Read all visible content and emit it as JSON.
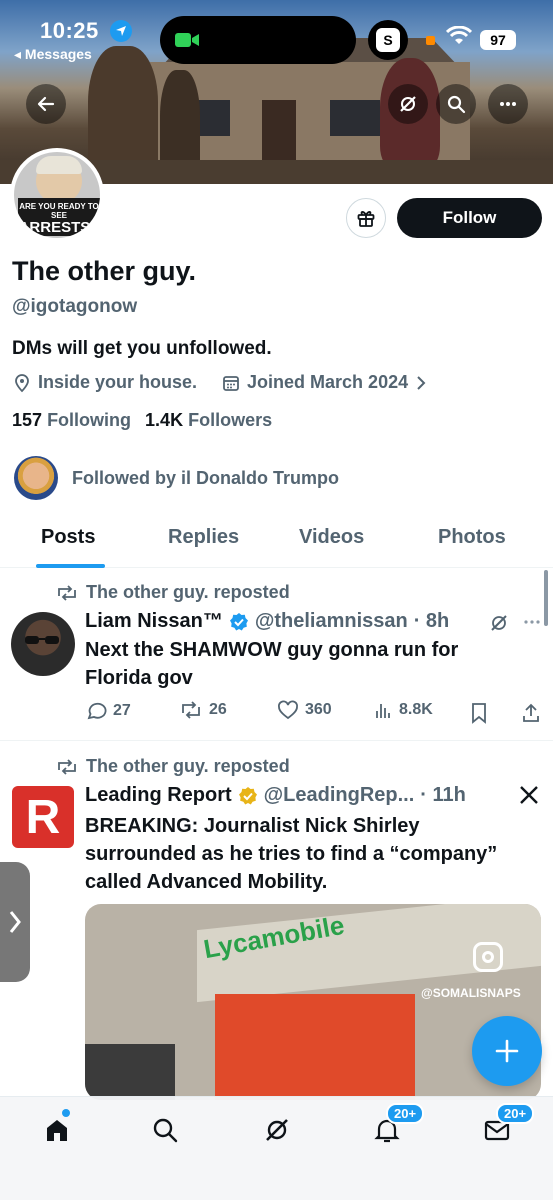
{
  "status_bar": {
    "time": "10:25",
    "back_app": "◂ Messages",
    "battery": "97",
    "app_pill_letter": "S"
  },
  "profile": {
    "name": "The other guy.",
    "handle": "@igotagonow",
    "bio": "DMs will get you unfollowed.",
    "location": "Inside your house.",
    "joined": "Joined March 2024",
    "following_count": "157",
    "following_label": "Following",
    "followers_count": "1.4K",
    "followers_label": "Followers",
    "followed_by": "Followed by il Donaldo Trumpo",
    "follow_button": "Follow",
    "avatar_sign_top": "ARE YOU READY TO SEE",
    "avatar_sign_main": "ARRESTS?"
  },
  "tabs": [
    "Posts",
    "Replies",
    "Videos",
    "Photos"
  ],
  "active_tab": "Posts",
  "posts": [
    {
      "repost_label": "The other guy. reposted",
      "author": "Liam Nissan™",
      "handle": "@theliamnissan",
      "time": "· 8h",
      "text": "Next the SHAMWOW guy gonna run for Florida gov",
      "replies": "27",
      "reposts": "26",
      "likes": "360",
      "views": "8.8K",
      "verified_color": "#1d9bf0"
    },
    {
      "repost_label": "The other guy. reposted",
      "author": "Leading Report",
      "handle": "@LeadingRep...",
      "time": "· 11h",
      "text": "BREAKING: Journalist Nick Shirley surrounded as he tries to find a “company” called Advanced Mobility.",
      "logo_letter": "R",
      "verified_color": "#e8b418",
      "media_watermark": "@SOMALISNAPS",
      "media_sign_text": "Lycamobile"
    }
  ],
  "bottom_nav": {
    "notifications_badge": "20+",
    "messages_badge": "20+"
  },
  "colors": {
    "accent": "#1d9bf0",
    "text_primary": "#0f1419",
    "text_secondary": "#536471"
  }
}
